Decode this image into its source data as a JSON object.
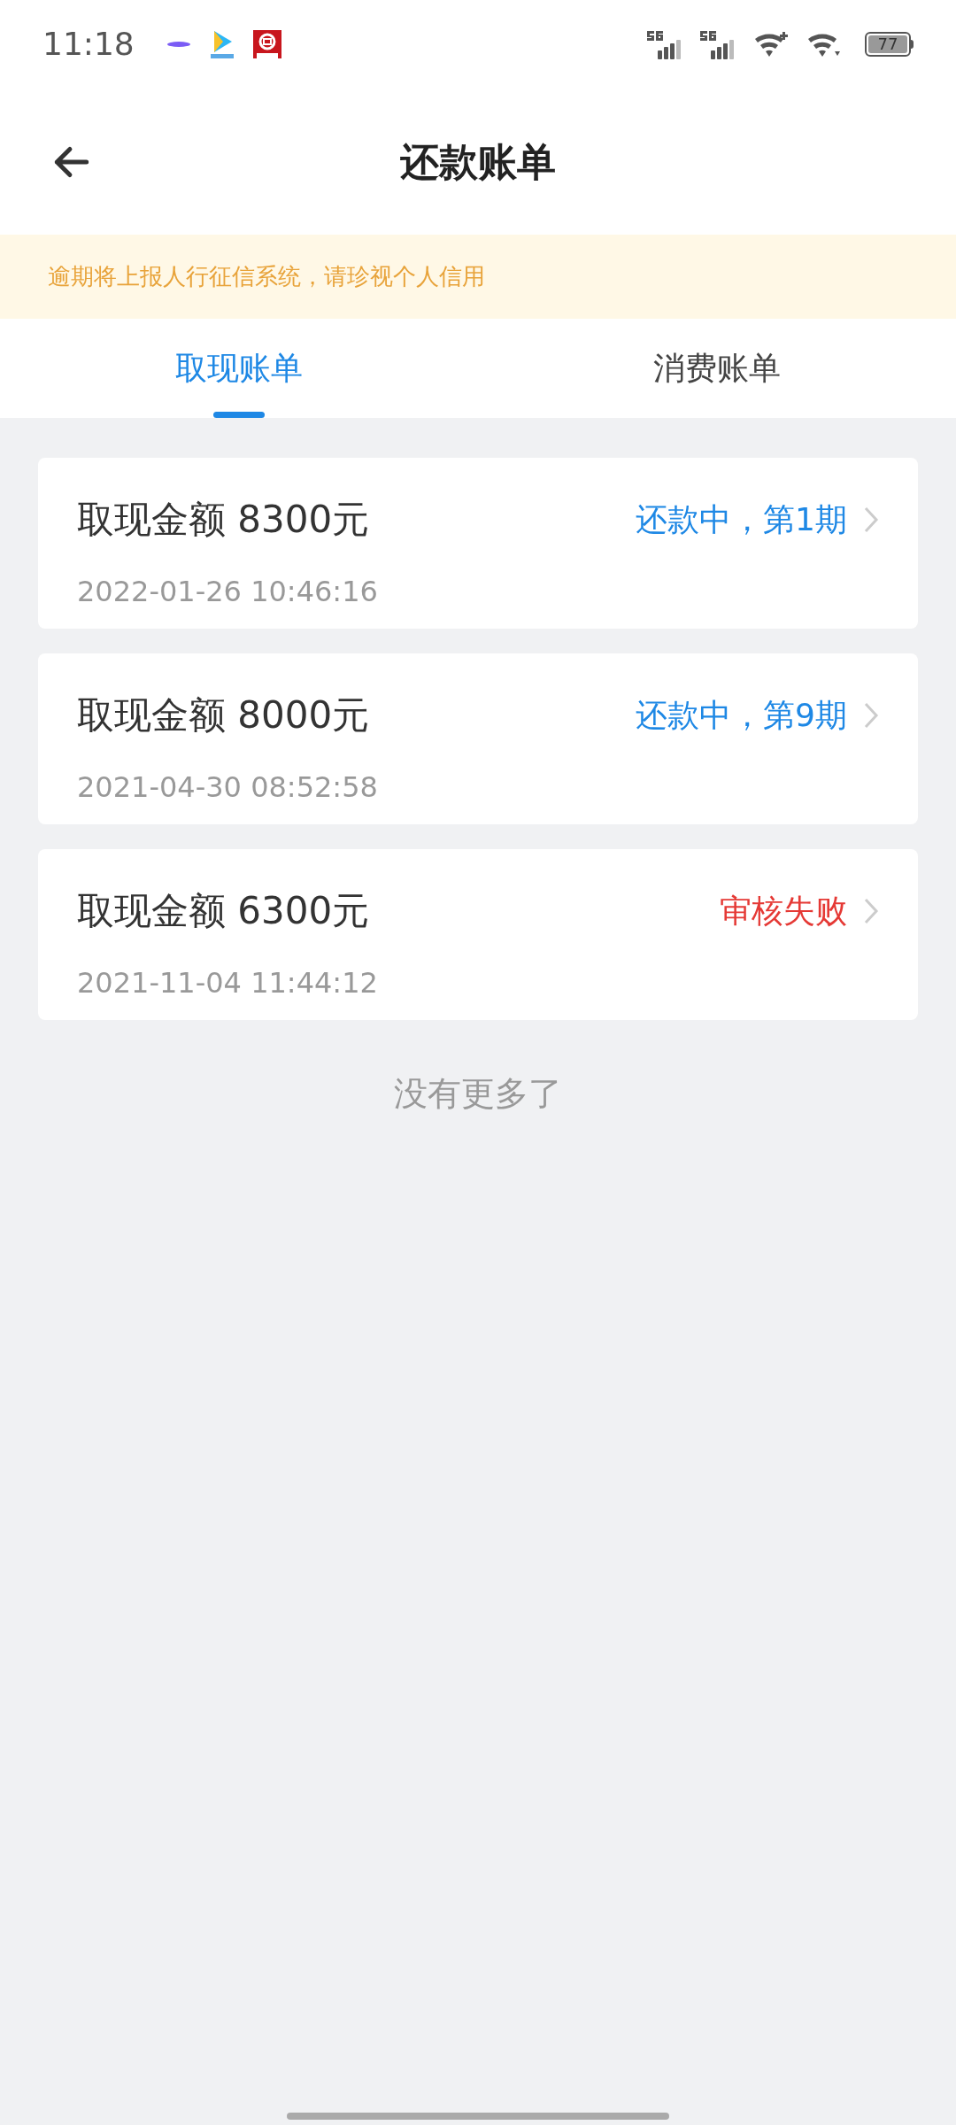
{
  "status_bar": {
    "time": "11:18",
    "battery": "77"
  },
  "header": {
    "title": "还款账单"
  },
  "notice": "逾期将上报人行征信系统，请珍视个人信用",
  "tabs": [
    {
      "label": "取现账单",
      "selected": true
    },
    {
      "label": "消费账单",
      "selected": false
    }
  ],
  "bills": [
    {
      "title": "取现金额 8300元",
      "status": "还款中，第1期",
      "kind": "repaying",
      "time": "2022-01-26 10:46:16"
    },
    {
      "title": "取现金额 8000元",
      "status": "还款中，第9期",
      "kind": "repaying",
      "time": "2021-04-30 08:52:58"
    },
    {
      "title": "取现金额 6300元",
      "status": "审核失败",
      "kind": "failed",
      "time": "2021-11-04 11:44:12"
    }
  ],
  "footer": "没有更多了"
}
